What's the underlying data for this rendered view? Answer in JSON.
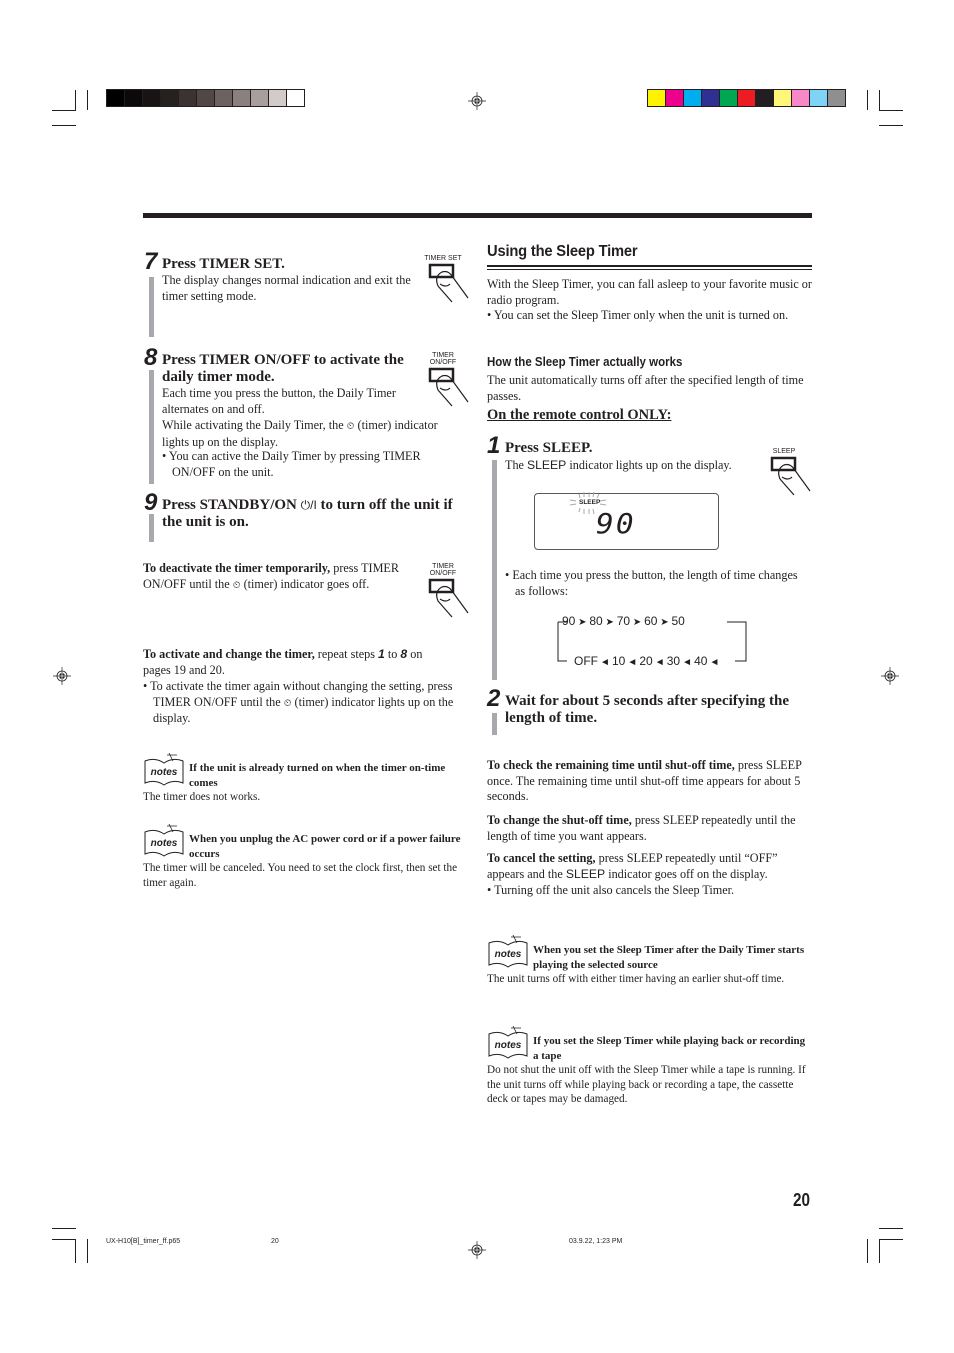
{
  "print_marks": {
    "gray_swatches": [
      "#000000",
      "#0b0909",
      "#171413",
      "#26211f",
      "#3b3231",
      "#514745",
      "#6d6260",
      "#8a807e",
      "#a89f9d",
      "#d2cbca",
      "#ffffff"
    ],
    "color_swatches": [
      "#fff200",
      "#ec008c",
      "#00aeef",
      "#2e3192",
      "#00a651",
      "#ed1c24",
      "#231f20",
      "#fff67a",
      "#f787c8",
      "#7dd4f7",
      "#8f8f8f"
    ]
  },
  "left": {
    "step7": {
      "num": "7",
      "title": "Press TIMER SET.",
      "body": "The display changes normal indication and exit the timer setting mode.",
      "button_label": "TIMER SET"
    },
    "step8": {
      "num": "8",
      "title_line1": "Press TIMER ON/OFF to activate the",
      "title_line2": "daily timer mode.",
      "p1": "Each time you press the button, the Daily Timer alternates on and off.",
      "p2a": "While activating the Daily Timer, the",
      "timer_glyph": "⏲",
      "p2b": "(timer) indicator lights up on the display.",
      "bullet": "•  You can active the Daily Timer by pressing TIMER ON/OFF on the unit.",
      "button_label_1": "TIMER",
      "button_label_2": "ON/OFF"
    },
    "step9": {
      "num": "9",
      "title_a": "Press STANDBY/ON",
      "standby_glyph": "⏻/I",
      "title_b": "to turn off the unit if the unit is on."
    },
    "deactivate": {
      "bold": "To deactivate the timer temporarily,",
      "text_a": " press TIMER ON/OFF until the",
      "text_b": "(timer) indicator goes off.",
      "button_label_1": "TIMER",
      "button_label_2": "ON/OFF"
    },
    "activate": {
      "bold": "To activate and change the timer,",
      "text_a": " repeat steps",
      "step_a": "1",
      "to": "to",
      "step_b": "8",
      "text_b": "on pages 19 and 20.",
      "bullet_a": "•  To activate the timer again without changing the setting, press TIMER ON/OFF until the",
      "bullet_b": "(timer) indicator lights up on the display."
    },
    "note1": {
      "icon_label": "notes",
      "title": "If the unit is already turned on when the timer on-time comes",
      "body": "The timer does not works."
    },
    "note2": {
      "icon_label": "notes",
      "title": "When you unplug the AC power cord or if a power failure occurs",
      "body": "The timer will be canceled. You need to set the clock first, then set the timer again."
    }
  },
  "right": {
    "section_title": "Using the Sleep Timer",
    "intro": "With the Sleep Timer, you can fall asleep to your favorite music or radio program.",
    "intro_bullet": "•  You can set the Sleep Timer only when the unit is turned on.",
    "how_title": "How the Sleep Timer actually works",
    "how_body": "The unit automatically turns off after the specified length of time passes.",
    "remote_only": "On the remote control ONLY:",
    "step1": {
      "num": "1",
      "title": "Press SLEEP.",
      "body_a": "The",
      "sleep_word": "SLEEP",
      "body_b": "indicator lights up on the display.",
      "button_label": "SLEEP",
      "display": {
        "indicator": "SLEEP",
        "value": "90"
      },
      "bullet": "•  Each time you press the button, the length of time changes as follows:",
      "sequence_top": [
        "90",
        "80",
        "70",
        "60",
        "50"
      ],
      "sequence_bottom": [
        "OFF",
        "10",
        "20",
        "30",
        "40"
      ]
    },
    "step2": {
      "num": "2",
      "title": "Wait for about 5 seconds after specifying the length of time."
    },
    "check": {
      "bold": "To check the remaining time until shut-off time,",
      "text": " press SLEEP once. The remaining time until shut-off time appears for about 5 seconds."
    },
    "change": {
      "bold": "To change the shut-off time,",
      "text": " press SLEEP repeatedly until the length of time you want appears."
    },
    "cancel": {
      "bold": "To cancel the setting,",
      "text_a": " press SLEEP repeatedly until “OFF” appears and the",
      "sleep_word": "SLEEP",
      "text_b": "indicator goes off on the display.",
      "bullet": "•  Turning off the unit also cancels the Sleep Timer."
    },
    "note3": {
      "icon_label": "notes",
      "title": "When you set the Sleep Timer after the Daily Timer starts playing the selected source",
      "body": "The unit turns off with either timer having an earlier shut-off time."
    },
    "note4": {
      "icon_label": "notes",
      "title": "If you set the Sleep Timer while playing back or recording a tape",
      "body": "Do not shut the unit off with the Sleep Timer while a tape is running. If the unit turns off while playing back or recording a tape, the cassette deck or tapes may be damaged."
    }
  },
  "page_number": "20",
  "footer": {
    "file": "UX-H10[B]_timer_ff.p65",
    "page": "20",
    "timestamp": "03.9.22, 1:23 PM"
  }
}
